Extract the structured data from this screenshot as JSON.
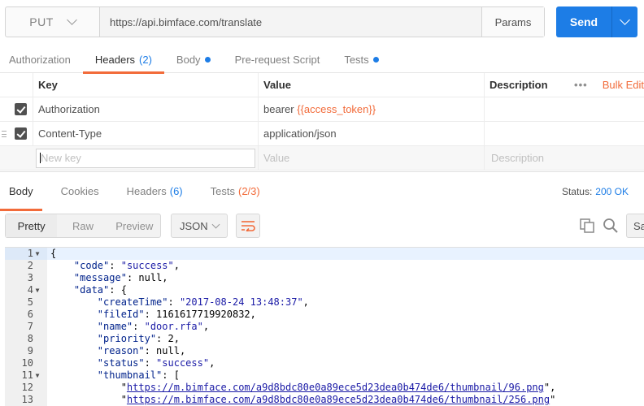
{
  "request": {
    "method": "PUT",
    "url": "https://api.bimface.com/translate",
    "params_label": "Params",
    "send_label": "Send"
  },
  "request_tabs": [
    {
      "label": "Authorization",
      "count": "",
      "dot": false,
      "active": false
    },
    {
      "label": "Headers",
      "count": "(2)",
      "dot": false,
      "active": true
    },
    {
      "label": "Body",
      "count": "",
      "dot": true,
      "active": false
    },
    {
      "label": "Pre-request Script",
      "count": "",
      "dot": false,
      "active": false
    },
    {
      "label": "Tests",
      "count": "",
      "dot": true,
      "active": false
    }
  ],
  "headers_table": {
    "columns": [
      "Key",
      "Value",
      "Description"
    ],
    "more_label": "•••",
    "bulk_edit_label": "Bulk Edit",
    "rows": [
      {
        "key": "Authorization",
        "value_prefix": "bearer ",
        "value_var": "{{access_token}}",
        "checked": true
      },
      {
        "key": "Content-Type",
        "value_prefix": "application/json",
        "value_var": "",
        "checked": true
      }
    ],
    "new_row": {
      "key_placeholder": "New key",
      "value_placeholder": "Value",
      "description_placeholder": "Description"
    }
  },
  "response": {
    "tabs": [
      {
        "label": "Body",
        "count": ""
      },
      {
        "label": "Cookies",
        "count": ""
      },
      {
        "label": "Headers",
        "count": "(6)"
      },
      {
        "label": "Tests",
        "count": "(2/3)"
      }
    ],
    "status_label": "Status:",
    "status_value": "200 OK",
    "view_modes": [
      "Pretty",
      "Raw",
      "Preview"
    ],
    "format": "JSON",
    "save_label": "Save"
  },
  "code_lines": [
    {
      "n": "1",
      "fold": true,
      "text": "{"
    },
    {
      "n": "2",
      "fold": false,
      "text": "    \"code\": \"success\","
    },
    {
      "n": "3",
      "fold": false,
      "text": "    \"message\": null,"
    },
    {
      "n": "4",
      "fold": true,
      "text": "    \"data\": {"
    },
    {
      "n": "5",
      "fold": false,
      "text": "        \"createTime\": \"2017-08-24 13:48:37\","
    },
    {
      "n": "6",
      "fold": false,
      "text": "        \"fileId\": 1161617719920832,"
    },
    {
      "n": "7",
      "fold": false,
      "text": "        \"name\": \"door.rfa\","
    },
    {
      "n": "8",
      "fold": false,
      "text": "        \"priority\": 2,"
    },
    {
      "n": "9",
      "fold": false,
      "text": "        \"reason\": null,"
    },
    {
      "n": "10",
      "fold": false,
      "text": "        \"status\": \"success\","
    },
    {
      "n": "11",
      "fold": true,
      "text": "        \"thumbnail\": ["
    },
    {
      "n": "12",
      "fold": false,
      "text": "            \"https://m.bimface.com/a9d8bdc80e0a89ece5d23dea0b474de6/thumbnail/96.png\","
    },
    {
      "n": "13",
      "fold": false,
      "text": "            \"https://m.bimface.com/a9d8bdc80e0a89ece5d23dea0b474de6/thumbnail/256.png\""
    }
  ],
  "colors": {
    "accent": "#f26b3a",
    "primary": "#1d7de6"
  }
}
